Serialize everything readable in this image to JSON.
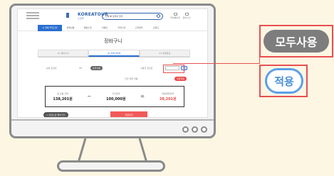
{
  "site": {
    "brand": "KOREATOUR",
    "brand_sub": "쇼핑몰",
    "search_category": "전체 ▼",
    "search_placeholder": "검색어 입력",
    "header_icons": [
      "마이페이지",
      "장바구니"
    ]
  },
  "nav": {
    "category_button": "≡ 전체 카테고리",
    "items": [
      "판매상품",
      "제품소개",
      "이벤트",
      "커뮤니티",
      "고객센터",
      "브랜드"
    ]
  },
  "cart": {
    "title": "장바구니",
    "tabs": [
      "01 장바구니",
      "02 주문서작성",
      "03 주문완료"
    ],
    "active_tab": 1,
    "row1": {
      "label_a": "보유 포인트",
      "value_a": "0P",
      "pill": "모두사용",
      "label_b": "사용할 포인트",
      "input_value": "",
      "apply": "적용"
    },
    "row2": {
      "label": "할인 쿠폰 적용",
      "button": "쿠폰적용"
    },
    "summary": {
      "total_label": "총 상품 금액",
      "total_value": "138,201원",
      "discount_label": "할인금액",
      "discount_value": "100,000원",
      "final_label": "최종결제금액",
      "final_value": "38,201원",
      "minus": "−",
      "equals": "="
    },
    "back_button": "< 이전으로 돌아가기",
    "order_button": "주문하기"
  },
  "callouts": {
    "use_all": "모두사용",
    "apply": "적용",
    "colors": {
      "highlight": "#e85050",
      "apply_blue": "#4a8fd8"
    }
  }
}
